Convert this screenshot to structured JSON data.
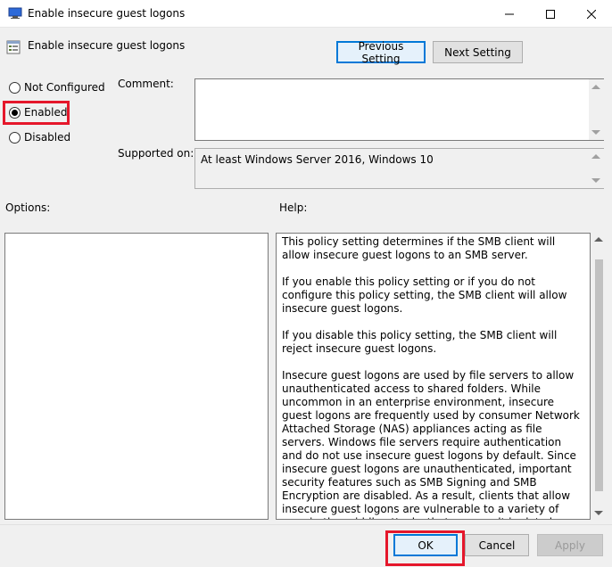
{
  "window": {
    "title": "Enable insecure guest logons"
  },
  "header": {
    "title": "Enable insecure guest logons",
    "prev_label": "Previous Setting",
    "next_label": "Next Setting"
  },
  "state": {
    "options": [
      "Not Configured",
      "Enabled",
      "Disabled"
    ],
    "selected": "Enabled"
  },
  "labels": {
    "comment": "Comment:",
    "supported_on": "Supported on:",
    "options": "Options:",
    "help": "Help:"
  },
  "supported_on_value": "At least Windows Server 2016, Windows 10",
  "comment_value": "",
  "help": {
    "paragraphs": [
      "This policy setting determines if the SMB client will allow insecure guest logons to an SMB server.",
      "If you enable this policy setting or if you do not configure this policy setting, the SMB client will allow insecure guest logons.",
      "If you disable this policy setting, the SMB client will reject insecure guest logons.",
      "Insecure guest logons are used by file servers to allow unauthenticated access to shared folders. While uncommon in an enterprise environment, insecure guest logons are frequently used by consumer Network Attached Storage (NAS) appliances acting as file servers. Windows file servers require authentication and do not use insecure guest logons by default. Since insecure guest logons are unauthenticated, important security features such as SMB Signing and SMB Encryption are disabled. As a result, clients that allow insecure guest logons are vulnerable to a variety of man-in-the-middle attacks that can result in data loss, data corruption, and exposure to malware. Additionally, any data written to a file server using an insecure guest logon is"
    ]
  },
  "footer": {
    "ok_label": "OK",
    "cancel_label": "Cancel",
    "apply_label": "Apply"
  },
  "colors": {
    "highlight": "#e5172b",
    "focus_border": "#0078d7"
  }
}
